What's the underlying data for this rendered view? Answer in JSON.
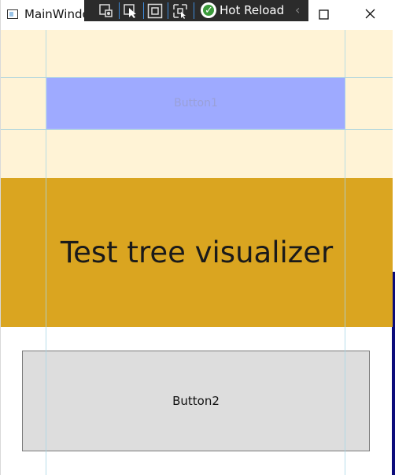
{
  "window": {
    "title": "MainWindow"
  },
  "toolbar": {
    "hot_reload_label": "Hot Reload",
    "icons": [
      "live-visual-tree-icon",
      "select-element-icon",
      "display-layout-adorners-icon",
      "track-focus-icon"
    ]
  },
  "content": {
    "button1_label": "Button1",
    "heading": "Test tree visualizer",
    "button2_label": "Button2"
  },
  "colors": {
    "row_background": "#fff3d6",
    "button1_background": "#9eaaff",
    "heading_background": "#daa520",
    "button2_background": "#dddddd",
    "toolbar_background": "#2b2b2b"
  }
}
